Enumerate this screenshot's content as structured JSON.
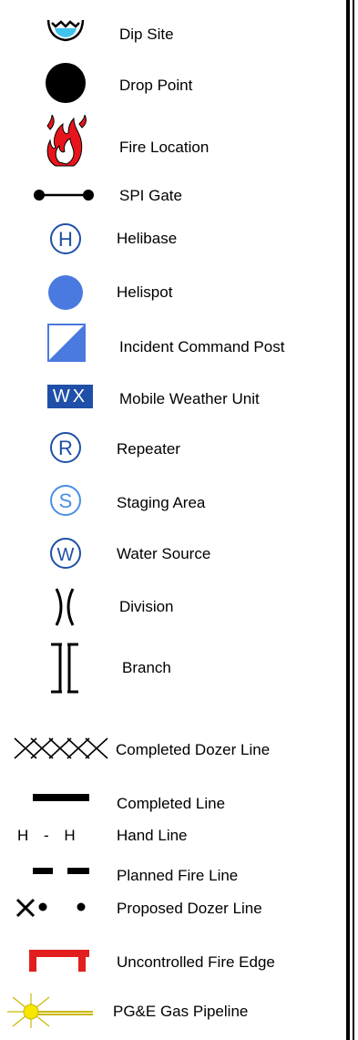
{
  "legend": {
    "items": [
      {
        "label": "Dip Site",
        "icon": "dip-site-icon"
      },
      {
        "label": "Drop Point",
        "icon": "drop-point-icon"
      },
      {
        "label": "Fire Location",
        "icon": "fire-icon"
      },
      {
        "label": "SPI Gate",
        "icon": "spi-gate-icon"
      },
      {
        "label": "Helibase",
        "icon": "helibase-icon",
        "glyph": "H"
      },
      {
        "label": "Helispot",
        "icon": "helispot-icon"
      },
      {
        "label": "Incident Command Post",
        "icon": "icp-icon"
      },
      {
        "label": "Mobile Weather Unit",
        "icon": "weather-unit-icon",
        "glyph": "WX"
      },
      {
        "label": "Repeater",
        "icon": "repeater-icon",
        "glyph": "R"
      },
      {
        "label": "Staging Area",
        "icon": "staging-area-icon",
        "glyph": "S"
      },
      {
        "label": "Water Source",
        "icon": "water-source-icon",
        "glyph": "W"
      },
      {
        "label": "Division",
        "icon": "division-icon"
      },
      {
        "label": "Branch",
        "icon": "branch-icon"
      },
      {
        "label": "Completed Dozer Line",
        "icon": "completed-dozer-line-icon"
      },
      {
        "label": "Completed Line",
        "icon": "completed-line-icon"
      },
      {
        "label": "Hand Line",
        "icon": "hand-line-icon",
        "glyph": "H - H"
      },
      {
        "label": "Planned Fire Line",
        "icon": "planned-fire-line-icon"
      },
      {
        "label": "Proposed Dozer Line",
        "icon": "proposed-dozer-line-icon"
      },
      {
        "label": "Uncontrolled Fire Edge",
        "icon": "uncontrolled-fire-edge-icon"
      },
      {
        "label": "PG&E Gas Pipeline",
        "icon": "gas-pipeline-icon"
      }
    ]
  },
  "colors": {
    "dip_water": "#3fc4ee",
    "helispot_blue": "#4a79e0",
    "circle_letter_blue": "#1f4fa8",
    "staging_light_blue": "#4a8fe6",
    "fire_red": "#e8141c",
    "edge_red": "#e21e1e",
    "pipeline_yellow": "#f6e600"
  }
}
